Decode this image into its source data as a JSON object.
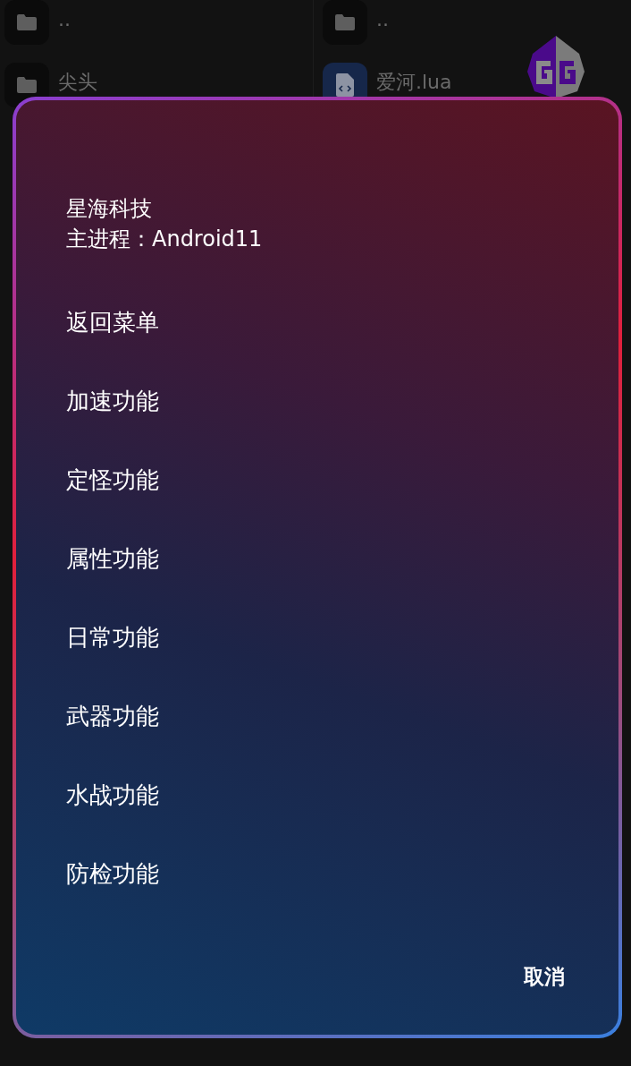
{
  "file_browser": {
    "left_column": [
      {
        "kind": "folder",
        "name": ".."
      },
      {
        "kind": "folder",
        "name": "尖头"
      }
    ],
    "right_column": [
      {
        "kind": "folder",
        "name": ".."
      },
      {
        "kind": "script",
        "name": "爱河.lua"
      }
    ]
  },
  "dialog": {
    "title": "星海科技",
    "subtitle": "主进程：Android11",
    "items": [
      "返回菜单",
      "加速功能",
      "定怪功能",
      "属性功能",
      "日常功能",
      "武器功能",
      "水战功能",
      "防检功能"
    ],
    "cancel": "取消"
  }
}
